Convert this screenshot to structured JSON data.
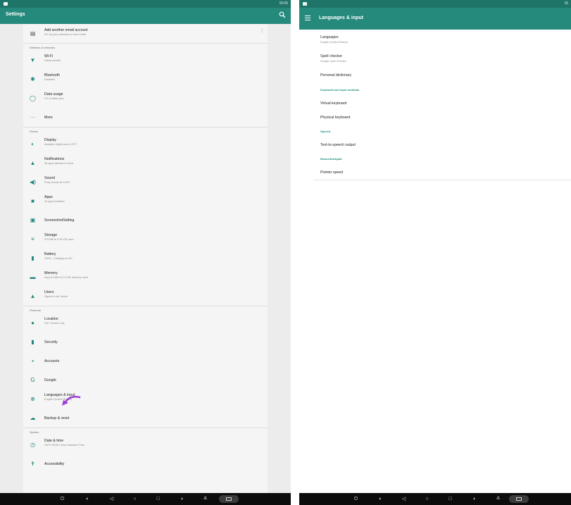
{
  "left": {
    "status_time": "16:06",
    "app_title": "Settings",
    "account_row": {
      "title": "Add another email account",
      "subtitle": "Set up your personal or work email"
    },
    "sections": [
      {
        "header": "Wireless & networks",
        "items": [
          {
            "icon": "wifi-icon",
            "glyph": "▼",
            "title": "Wi-Fi",
            "subtitle": "Disconnected"
          },
          {
            "icon": "bluetooth-icon",
            "glyph": "✱",
            "title": "Bluetooth",
            "subtitle": "Disabled"
          },
          {
            "icon": "data-usage-icon",
            "glyph": "◯",
            "title": "Data usage",
            "subtitle": "0 B of data used"
          },
          {
            "icon": "more-icon",
            "glyph": "···",
            "title": "More",
            "subtitle": ""
          }
        ]
      },
      {
        "header": "Device",
        "items": [
          {
            "icon": "display-icon",
            "glyph": "◐",
            "title": "Display",
            "subtitle": "Adaptive brightness is OFF"
          },
          {
            "icon": "notifications-icon",
            "glyph": "▲",
            "title": "Notifications",
            "subtitle": "All apps allowed to send"
          },
          {
            "icon": "sound-icon",
            "glyph": "◀)",
            "title": "Sound",
            "subtitle": "Ring volume at 100%"
          },
          {
            "icon": "apps-icon",
            "glyph": "■",
            "title": "Apps",
            "subtitle": "24 apps installed"
          },
          {
            "icon": "screenshot-icon",
            "glyph": "▣",
            "title": "ScreenshotSetting",
            "subtitle": ""
          },
          {
            "icon": "storage-icon",
            "glyph": "≡",
            "title": "Storage",
            "subtitle": "579 MB of 4.80 GB used"
          },
          {
            "icon": "battery-icon",
            "glyph": "▮",
            "title": "Battery",
            "subtitle": "100% - Charging on AC"
          },
          {
            "icon": "memory-icon",
            "glyph": "▬",
            "title": "Memory",
            "subtitle": "Avg 513 MB of 1.9 GB memory used"
          },
          {
            "icon": "users-icon",
            "glyph": "▲",
            "title": "Users",
            "subtitle": "Signed in as Owner"
          }
        ]
      },
      {
        "header": "Personal",
        "items": [
          {
            "icon": "location-icon",
            "glyph": "●",
            "title": "Location",
            "subtitle": "ON / Device only"
          },
          {
            "icon": "security-icon",
            "glyph": "▮",
            "title": "Security",
            "subtitle": ""
          },
          {
            "icon": "accounts-icon",
            "glyph": "▪",
            "title": "Accounts",
            "subtitle": ""
          },
          {
            "icon": "google-icon",
            "glyph": "G",
            "title": "Google",
            "subtitle": ""
          },
          {
            "icon": "globe-icon",
            "glyph": "⊕",
            "title": "Languages & input",
            "subtitle": "English (United States)"
          },
          {
            "icon": "backup-icon",
            "glyph": "☁",
            "title": "Backup & reset",
            "subtitle": ""
          }
        ]
      },
      {
        "header": "System",
        "items": [
          {
            "icon": "clock-icon",
            "glyph": "◷",
            "title": "Date & time",
            "subtitle": "GMT+08:00 China Standard Time"
          },
          {
            "icon": "accessibility-icon",
            "glyph": "✝",
            "title": "Accessibility",
            "subtitle": ""
          }
        ]
      }
    ]
  },
  "right": {
    "status_time": "16",
    "app_title": "Languages & input",
    "items": [
      {
        "title": "Languages",
        "subtitle": "English (United States)"
      },
      {
        "title": "Spell checker",
        "subtitle": "Google Spell Checker"
      },
      {
        "title": "Personal dictionary",
        "subtitle": ""
      }
    ],
    "header_keyboard": "Keyboard and input methods",
    "keyboard_items": [
      "Virtual keyboard",
      "Physical keyboard"
    ],
    "header_speech": "Speech",
    "speech_items": [
      "Text-to-speech output"
    ],
    "header_mouse": "Mouse/trackpad",
    "mouse_items": [
      "Pointer speed"
    ]
  },
  "colors": {
    "appbar": "#25897c",
    "statusbar": "#1f7468",
    "accent": "#1f8f7f",
    "arrow": "#9b3fd6"
  }
}
